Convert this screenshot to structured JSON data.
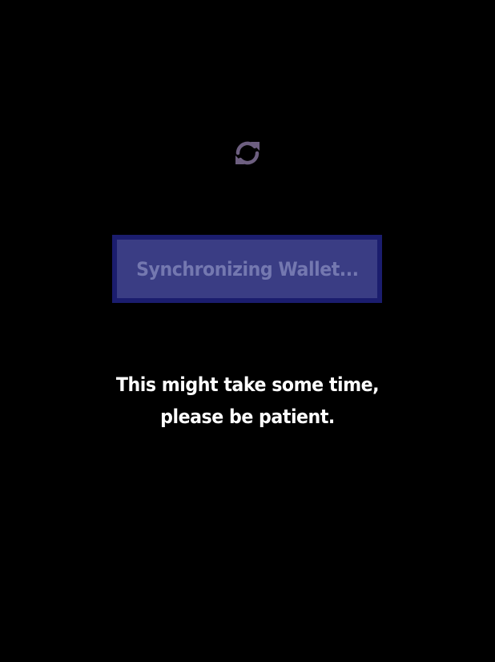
{
  "sync": {
    "icon": "sync-icon",
    "icon_color": "#6d5f80",
    "status_text": "Synchronizing Wallet...",
    "box_fill": "#3a3d84",
    "box_border": "#1b1d6e",
    "text_color": "#7478b0"
  },
  "message": {
    "line1": "This might take some time,",
    "line2": "please be patient."
  }
}
